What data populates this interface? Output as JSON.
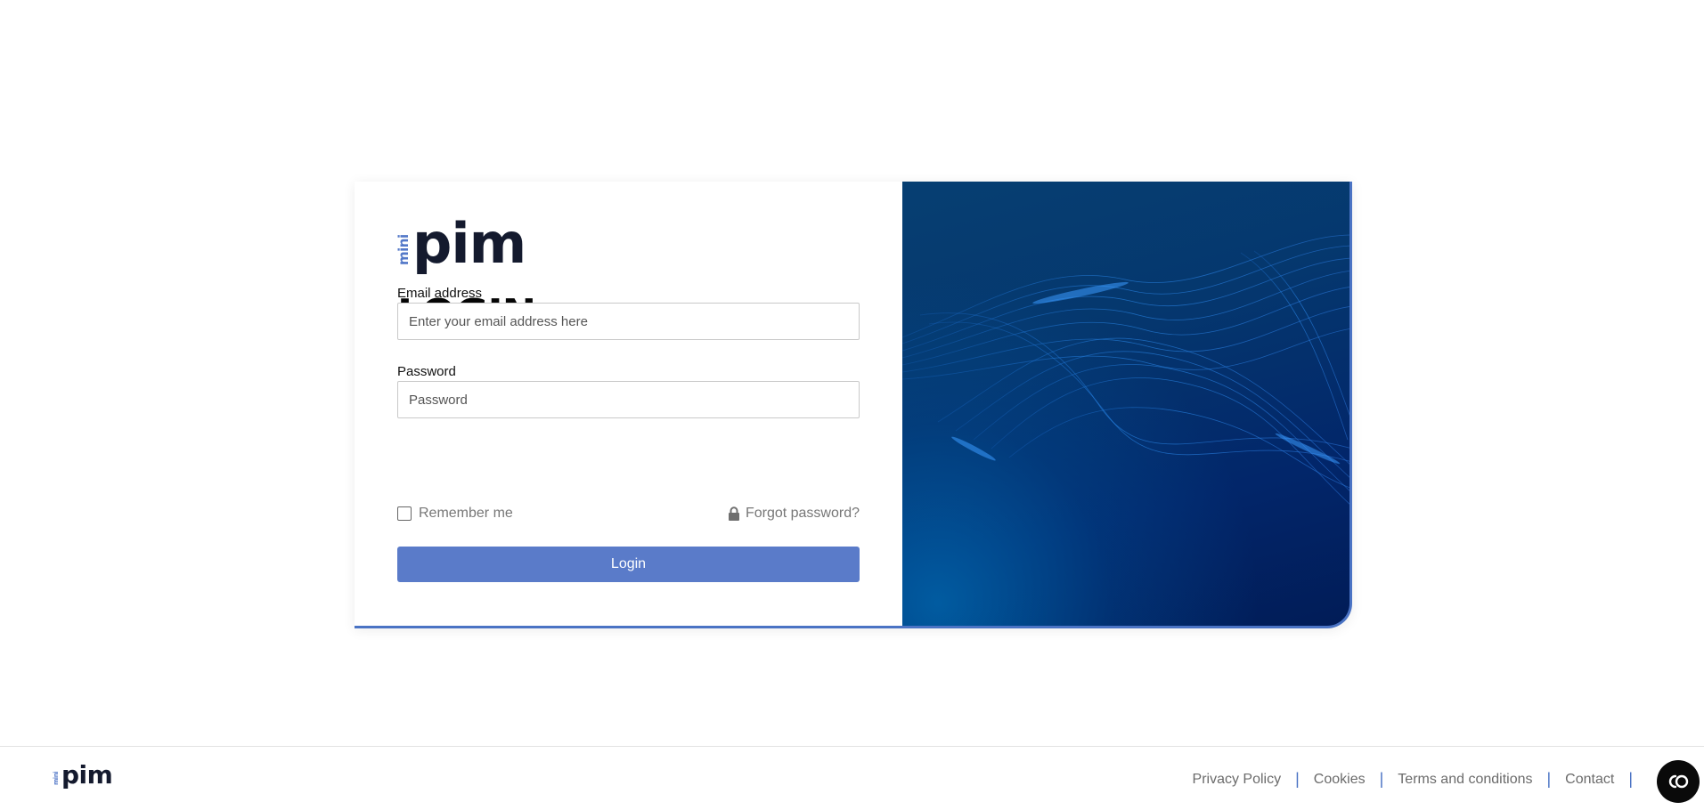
{
  "logo": {
    "mini": "mini",
    "pim": "pim"
  },
  "form": {
    "title": "LOGIN",
    "email_label": "Email address",
    "email_placeholder": "Enter your email address here",
    "email_value": "",
    "password_label": "Password",
    "password_placeholder": "Password",
    "password_value": "",
    "remember_label": "Remember me",
    "remember_checked": false,
    "forgot_label": "Forgot password?",
    "submit_label": "Login"
  },
  "footer": {
    "links": [
      "Privacy Policy",
      "Cookies",
      "Terms and conditions",
      "Contact"
    ]
  },
  "icons": {
    "forgot": "lock-icon",
    "chat": "chat-bubble-icon"
  },
  "colors": {
    "accent": "#4a73c4",
    "button": "#5a7bc9",
    "logo_dark": "#141a2e",
    "panel_dark": "#02266a"
  }
}
